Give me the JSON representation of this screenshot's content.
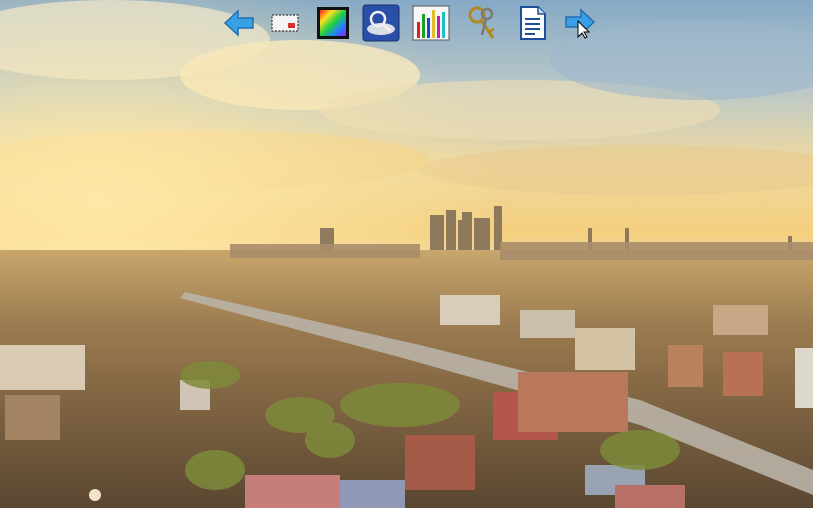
{
  "desktop": {
    "wallpaper": "city-skyline-sunset",
    "colors": {
      "sky_top": "#7ea3c3",
      "sky_glow": "#f3d27a",
      "horizon": "#e8b86a",
      "city": "#8a6b47",
      "accent_arrow": "#3aa0e6"
    }
  },
  "toolbar": {
    "items": [
      {
        "icon": "back-arrow-icon"
      },
      {
        "icon": "screen-capture-icon"
      },
      {
        "icon": "color-spectrum-icon"
      },
      {
        "icon": "image-search-icon"
      },
      {
        "icon": "bar-chart-icon"
      },
      {
        "icon": "keys-icon"
      },
      {
        "icon": "document-icon"
      },
      {
        "icon": "forward-arrow-icon"
      }
    ]
  }
}
